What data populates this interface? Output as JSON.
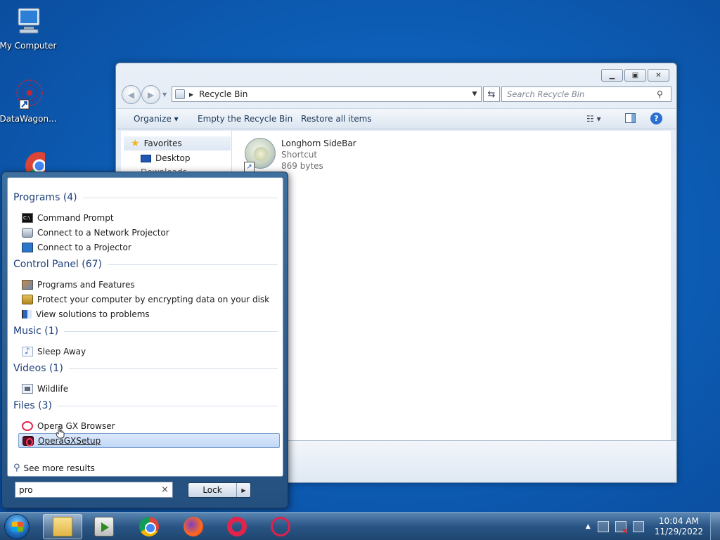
{
  "desktop": {
    "icons": [
      {
        "label": "My Computer",
        "icon": "computer-icon"
      },
      {
        "label": "DataWagon...",
        "icon": "datawagon-icon"
      },
      {
        "label": "",
        "icon": "chrome-icon"
      }
    ]
  },
  "explorer": {
    "address": {
      "location": "Recycle Bin"
    },
    "search": {
      "placeholder": "Search Recycle Bin"
    },
    "toolbar": {
      "organize": "Organize",
      "organize_caret": "▾",
      "empty": "Empty the Recycle Bin",
      "restore": "Restore all items",
      "view_caret": "▾",
      "help": "?"
    },
    "nav_pane": {
      "favorites": "Favorites",
      "items": [
        "Desktop",
        "Downloads"
      ]
    },
    "file": {
      "name": "Longhorn SideBar",
      "type": "Shortcut",
      "size": "869 bytes"
    }
  },
  "start_menu": {
    "groups": [
      {
        "heading": "Programs (4)",
        "items": [
          {
            "label": "Command Prompt",
            "icon": "cmd-icon"
          },
          {
            "label": "Connect to a Network Projector",
            "icon": "network-projector-icon"
          },
          {
            "label": "Connect to a Projector",
            "icon": "projector-icon"
          }
        ]
      },
      {
        "heading": "Control Panel (67)",
        "items": [
          {
            "label": "Programs and Features",
            "icon": "programs-features-icon"
          },
          {
            "label": "Protect your computer by encrypting data on your disk",
            "icon": "bitlocker-icon"
          },
          {
            "label": "View solutions to problems",
            "icon": "action-center-flag-icon"
          }
        ]
      },
      {
        "heading": "Music (1)",
        "items": [
          {
            "label": "Sleep Away",
            "icon": "music-file-icon"
          }
        ]
      },
      {
        "heading": "Videos (1)",
        "items": [
          {
            "label": "Wildlife",
            "icon": "video-file-icon"
          }
        ]
      },
      {
        "heading": "Files (3)",
        "items": [
          {
            "label": "Opera GX Browser",
            "icon": "opera-icon"
          },
          {
            "label": "OperaGXSetup",
            "icon": "opera-gx-setup-icon",
            "selected": true
          }
        ]
      }
    ],
    "see_more": "See more results",
    "search_value": "pro",
    "lock_label": "Lock",
    "clear_glyph": "×",
    "lock_arrow": "▶"
  },
  "taskbar": {
    "apps": [
      "windows-explorer-icon",
      "media-player-icon",
      "chrome-icon",
      "firefox-icon",
      "opera-icon",
      "opera-gx-icon"
    ],
    "tray_arrow": "▲",
    "time": "10:04 AM",
    "date": "11/29/2022"
  }
}
